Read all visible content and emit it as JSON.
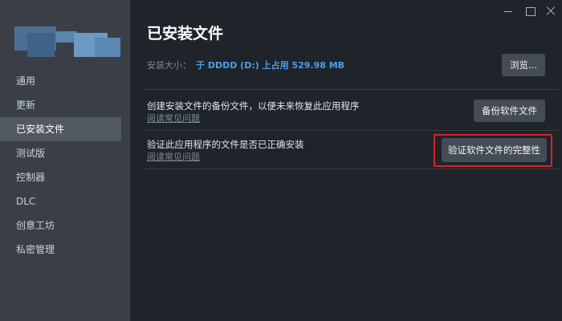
{
  "sidebar": {
    "items": [
      {
        "label": "通用",
        "active": false
      },
      {
        "label": "更新",
        "active": false
      },
      {
        "label": "已安装文件",
        "active": true
      },
      {
        "label": "测试版",
        "active": false
      },
      {
        "label": "控制器",
        "active": false
      },
      {
        "label": "DLC",
        "active": false
      },
      {
        "label": "创意工坊",
        "active": false
      },
      {
        "label": "私密管理",
        "active": false
      }
    ]
  },
  "main": {
    "title": "已安装文件",
    "install_size": {
      "label": "安装大小：",
      "value": "于 DDDD (D:) 上占用 529.98 MB"
    },
    "browse_label": "浏览...",
    "backup": {
      "description": "创建安装文件的备份文件，以便未来恢复此应用程序",
      "faq_link": "阅读常见问题",
      "button_label": "备份软件文件"
    },
    "verify": {
      "description": "验证此应用程序的文件是否已正确安装",
      "faq_link": "阅读常见问题",
      "button_label": "验证软件文件的完整性"
    }
  },
  "colors": {
    "accent": "#4aa0ee",
    "highlight": "#d8232a",
    "background": "#1f232a",
    "sidebar": "#3a3f47"
  }
}
